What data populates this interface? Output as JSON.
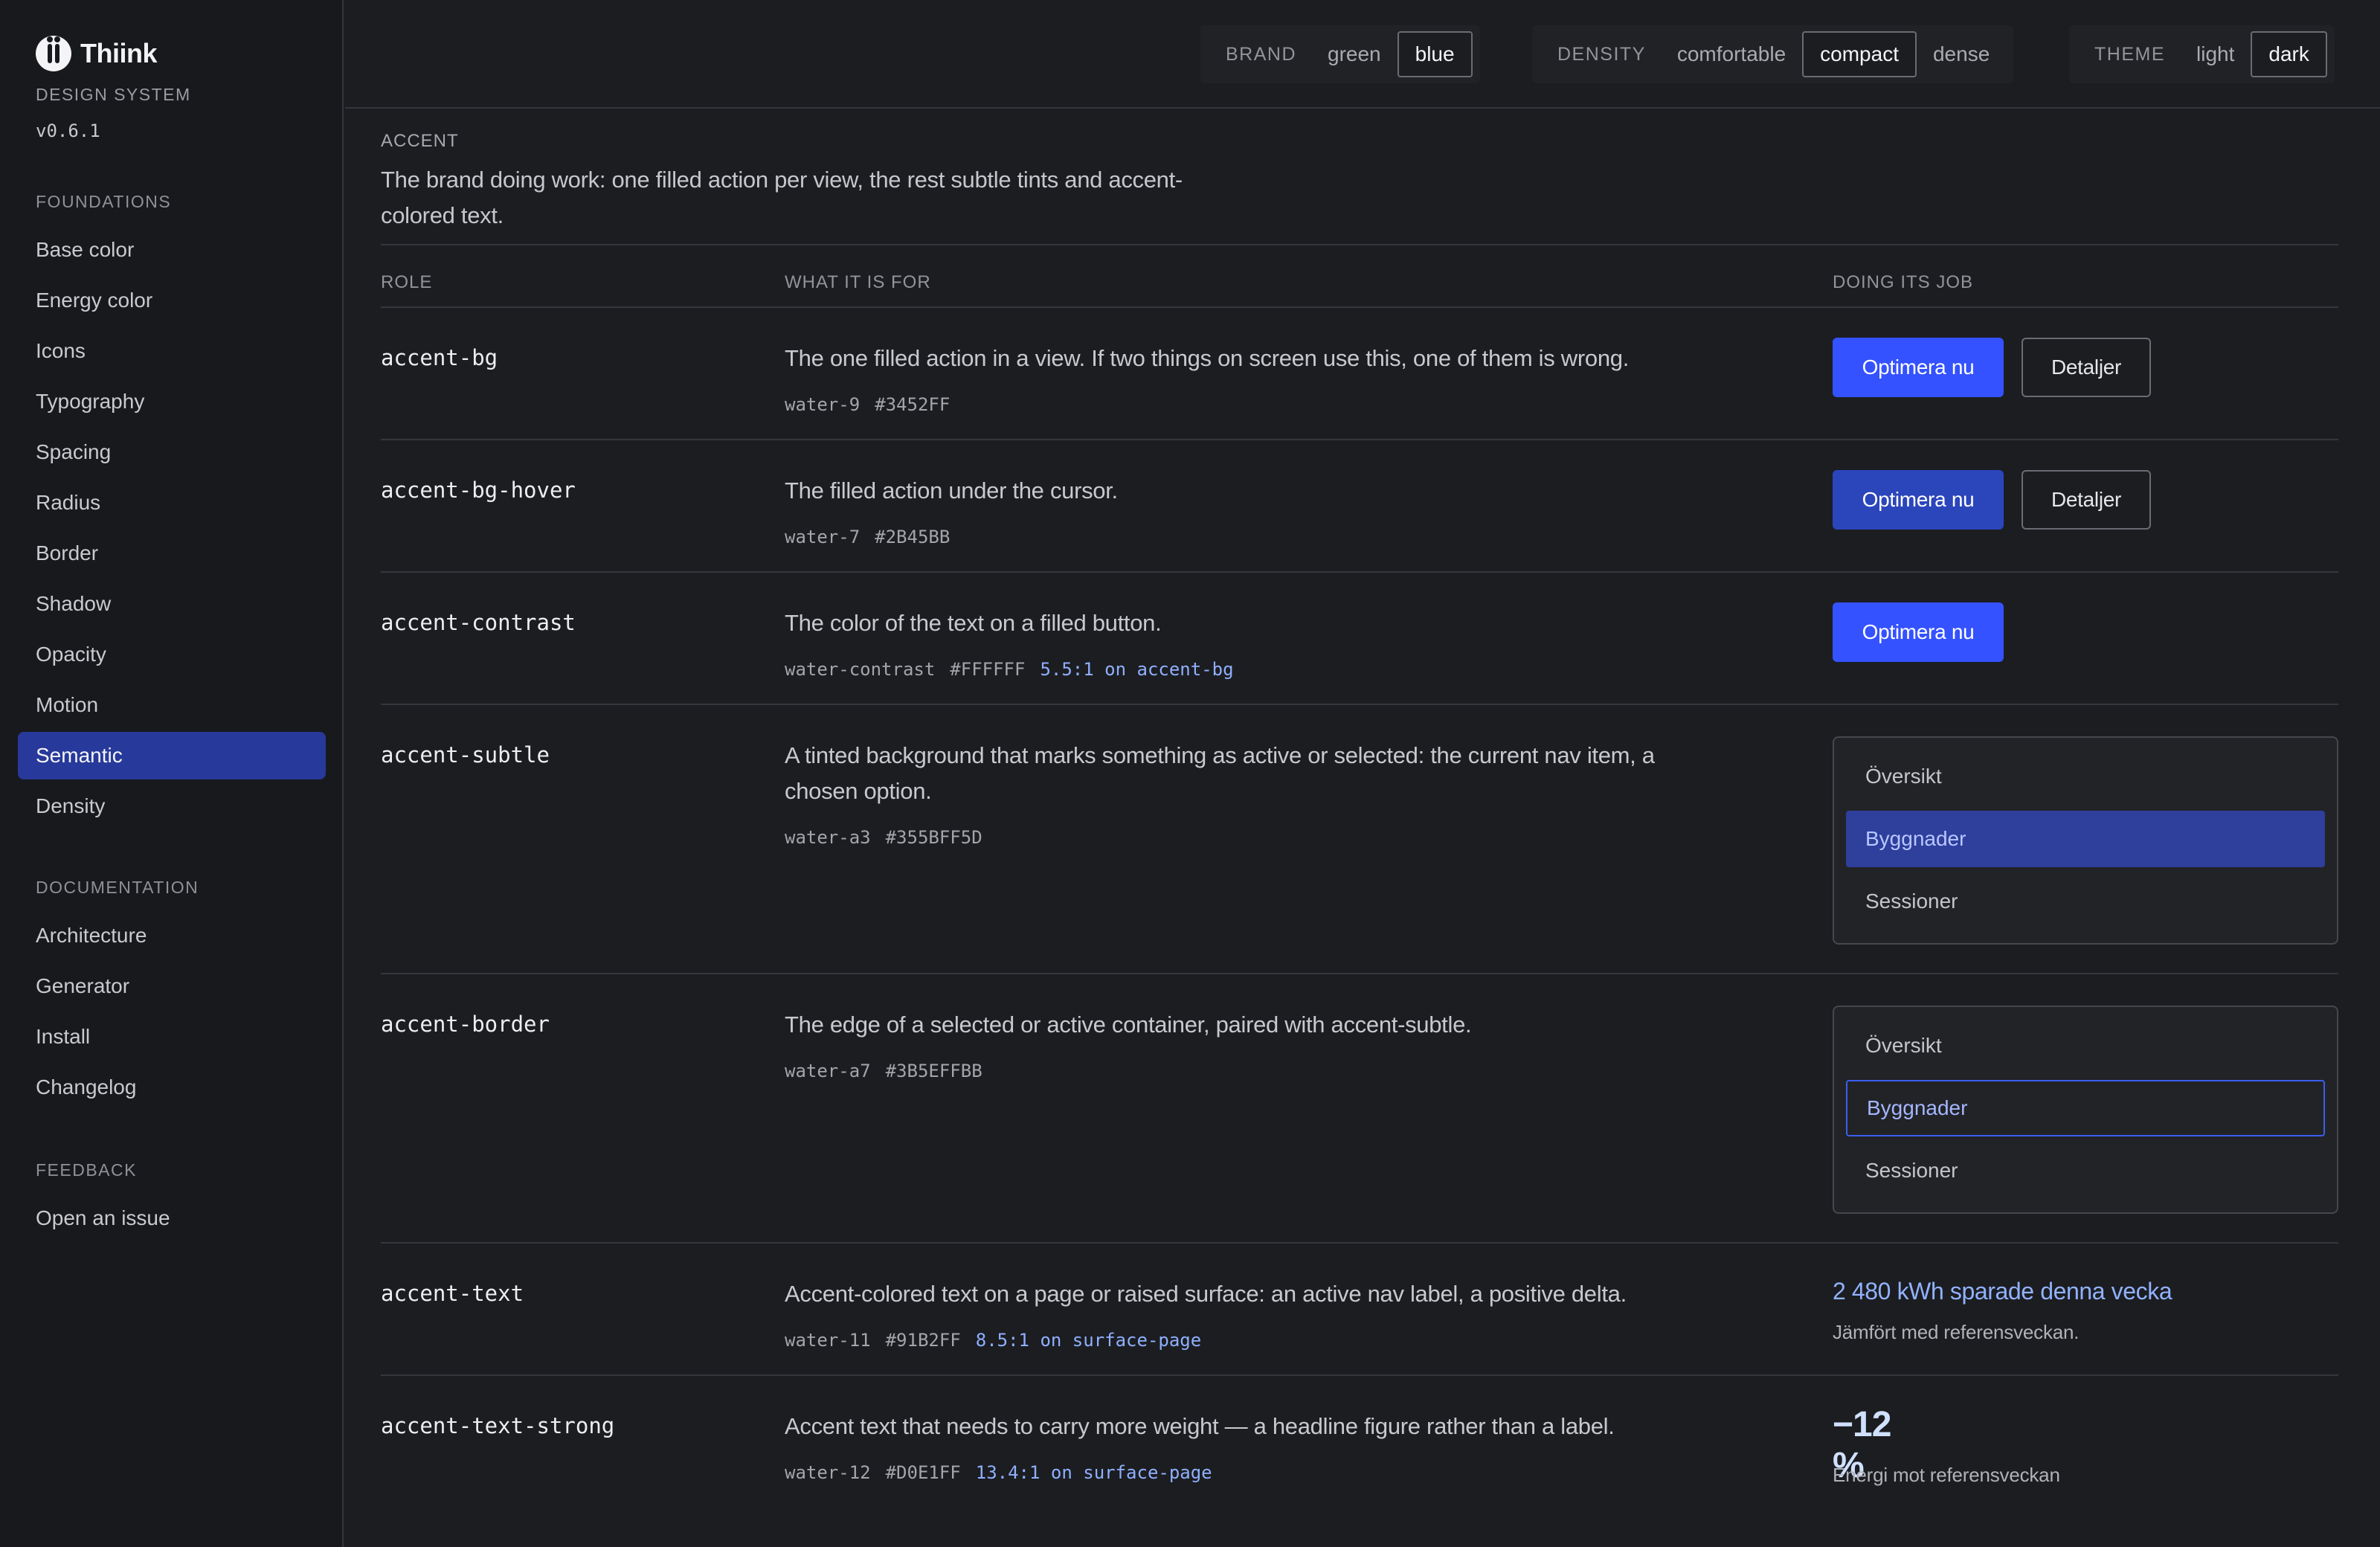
{
  "app": {
    "name": "Thiink",
    "subtitle": "DESIGN SYSTEM",
    "version": "v0.6.1"
  },
  "sidebar": {
    "foundations_label": "FOUNDATIONS",
    "foundations": [
      {
        "label": "Base color"
      },
      {
        "label": "Energy color"
      },
      {
        "label": "Icons"
      },
      {
        "label": "Typography"
      },
      {
        "label": "Spacing"
      },
      {
        "label": "Radius"
      },
      {
        "label": "Border"
      },
      {
        "label": "Shadow"
      },
      {
        "label": "Opacity"
      },
      {
        "label": "Motion"
      },
      {
        "label": "Semantic",
        "active": true
      },
      {
        "label": "Density"
      }
    ],
    "documentation_label": "DOCUMENTATION",
    "documentation": [
      {
        "label": "Architecture"
      },
      {
        "label": "Generator"
      },
      {
        "label": "Install"
      },
      {
        "label": "Changelog"
      }
    ],
    "feedback_label": "FEEDBACK",
    "feedback": [
      {
        "label": "Open an issue"
      }
    ]
  },
  "topbar": {
    "brand": {
      "label": "BRAND",
      "options": [
        "green",
        "blue"
      ],
      "selected": "blue"
    },
    "density": {
      "label": "DENSITY",
      "options": [
        "comfortable",
        "compact",
        "dense"
      ],
      "selected": "compact"
    },
    "theme": {
      "label": "THEME",
      "options": [
        "light",
        "dark"
      ],
      "selected": "dark"
    }
  },
  "section": {
    "label": "ACCENT",
    "description": "The brand doing work: one filled action per view, the rest subtle tints and accent-colored text.",
    "columns": {
      "role": "ROLE",
      "purpose": "WHAT IT IS FOR",
      "demo": "DOING ITS JOB"
    }
  },
  "rows": [
    {
      "role": "accent-bg",
      "purpose": "The one filled action in a view. If two things on screen use this, one of them is wrong.",
      "token": "water-9",
      "hex": "#3452FF",
      "demo": {
        "primary": "Optimera nu",
        "secondary": "Detaljer"
      }
    },
    {
      "role": "accent-bg-hover",
      "purpose": "The filled action under the cursor.",
      "token": "water-7",
      "hex": "#2B45BB",
      "demo": {
        "primary": "Optimera nu",
        "secondary": "Detaljer"
      }
    },
    {
      "role": "accent-contrast",
      "purpose": "The color of the text on a filled button.",
      "token": "water-contrast",
      "hex": "#FFFFFF",
      "ratio": "5.5:1 on accent-bg",
      "demo": {
        "primary": "Optimera nu"
      }
    },
    {
      "role": "accent-subtle",
      "purpose": "A tinted background that marks something as active or selected: the current nav item, a chosen option.",
      "token": "water-a3",
      "hex": "#355BFF5D",
      "demo": {
        "items": [
          "Översikt",
          "Byggnader",
          "Sessioner"
        ]
      }
    },
    {
      "role": "accent-border",
      "purpose": "The edge of a selected or active container, paired with accent-subtle.",
      "token": "water-a7",
      "hex": "#3B5EFFBB",
      "demo": {
        "items": [
          "Översikt",
          "Byggnader",
          "Sessioner"
        ]
      }
    },
    {
      "role": "accent-text",
      "purpose": "Accent-colored text on a page or raised surface: an active nav label, a positive delta.",
      "token": "water-11",
      "hex": "#91B2FF",
      "ratio": "8.5:1 on surface-page",
      "demo": {
        "headline": "2 480 kWh sparade denna vecka",
        "caption": "Jämfört med referensveckan."
      }
    },
    {
      "role": "accent-text-strong",
      "purpose": "Accent text that needs to carry more weight — a headline figure rather than a label.",
      "token": "water-12",
      "hex": "#D0E1FF",
      "ratio": "13.4:1 on surface-page",
      "demo": {
        "figure": "−12 %",
        "caption": "Energi mot referensveckan"
      }
    }
  ],
  "colors": {
    "accent_bg": "#3452FF",
    "accent_bg_hover": "#2B45BB",
    "accent_text": "#91B2FF",
    "accent_text_strong": "#D0E1FF",
    "active_nav": "#27399A"
  }
}
